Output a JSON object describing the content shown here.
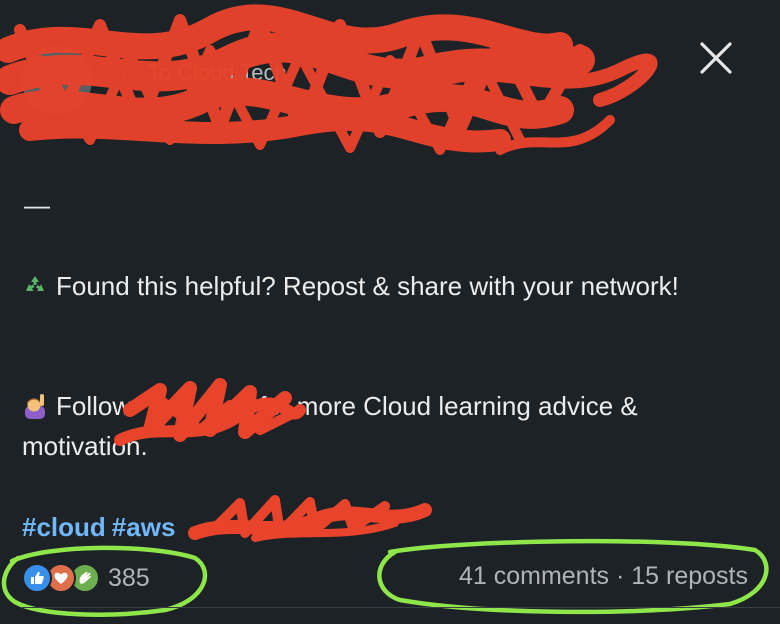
{
  "post": {
    "author_line": "… To Cloud Tech",
    "close_icon": "close-icon",
    "dash": "—",
    "paragraph1_emoji": "recycle-icon",
    "paragraph1": "Found this helpful? Repost & share with your network!",
    "paragraph2_emoji": "raising-hand-icon",
    "paragraph2_start": "Follow",
    "paragraph2_end": "for more Cloud learning advice & motivation.",
    "hashtags": [
      "#cloud",
      "#aws"
    ]
  },
  "social": {
    "reaction_icons": [
      "like-icon",
      "love-icon",
      "celebrate-icon"
    ],
    "reaction_count": "385",
    "comments": "41 comments",
    "separator": " · ",
    "reposts": "15 reposts"
  },
  "colors": {
    "background": "#1d2226",
    "hashtag": "#71b7fb",
    "redaction_red": "#e8432b",
    "highlight_green": "#8fe64a"
  }
}
